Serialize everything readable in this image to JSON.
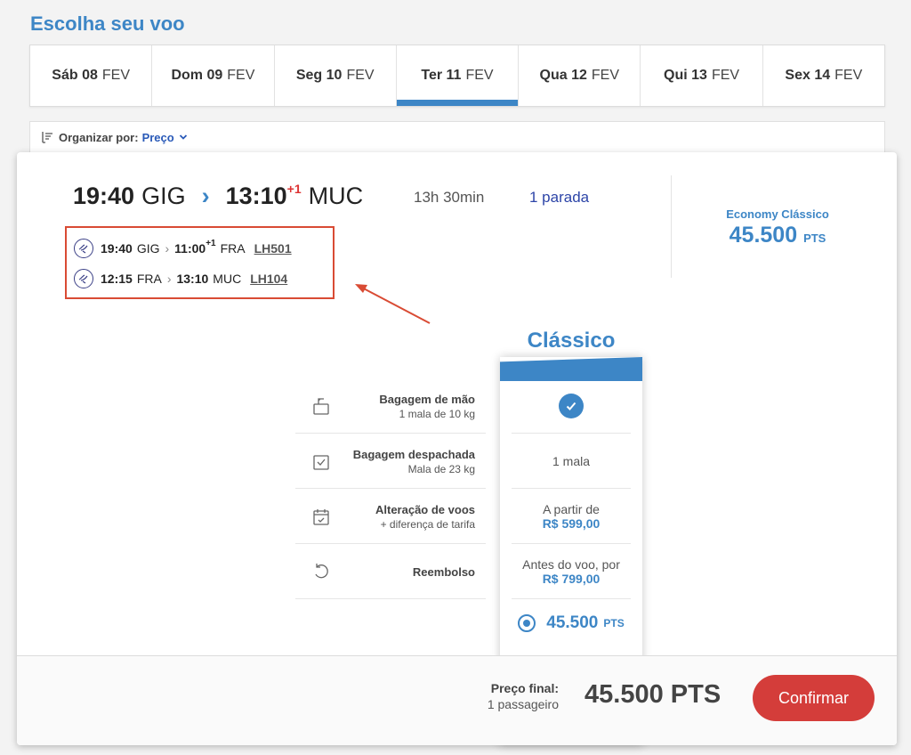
{
  "page_title": "Escolha seu voo",
  "date_tabs": [
    {
      "day": "Sáb 08",
      "month": "FEV",
      "active": false
    },
    {
      "day": "Dom 09",
      "month": "FEV",
      "active": false
    },
    {
      "day": "Seg 10",
      "month": "FEV",
      "active": false
    },
    {
      "day": "Ter 11",
      "month": "FEV",
      "active": true
    },
    {
      "day": "Qua 12",
      "month": "FEV",
      "active": false
    },
    {
      "day": "Qui 13",
      "month": "FEV",
      "active": false
    },
    {
      "day": "Sex 14",
      "month": "FEV",
      "active": false
    }
  ],
  "sort": {
    "label": "Organizar por:",
    "value": "Preço"
  },
  "flight": {
    "departure_time": "19:40",
    "departure_airport": "GIG",
    "arrival_time": "13:10",
    "arrival_day_offset": "+1",
    "arrival_airport": "MUC",
    "duration": "13h 30min",
    "stops": "1 parada",
    "segments": [
      {
        "dep_time": "19:40",
        "dep_airport": "GIG",
        "arr_time": "11:00",
        "arr_offset": "+1",
        "arr_airport": "FRA",
        "flight_code": "LH501"
      },
      {
        "dep_time": "12:15",
        "dep_airport": "FRA",
        "arr_time": "13:10",
        "arr_offset": "",
        "arr_airport": "MUC",
        "flight_code": "LH104"
      }
    ]
  },
  "economy": {
    "label": "Economy Clássico",
    "points": "45.500",
    "unit": "PTS"
  },
  "fare": {
    "name": "Clássico",
    "features": [
      {
        "title": "Bagagem de mão",
        "subtitle": "1 mala de 10 kg",
        "icon": "carry-on-bag-icon"
      },
      {
        "title": "Bagagem despachada",
        "subtitle": "Mala de 23 kg",
        "icon": "checked-bag-icon"
      },
      {
        "title": "Alteração de voos",
        "subtitle": "+ diferença de tarifa",
        "icon": "calendar-change-icon"
      },
      {
        "title": "Reembolso",
        "subtitle": "",
        "icon": "refund-icon"
      }
    ],
    "values": [
      {
        "text": "",
        "price": "",
        "check": true
      },
      {
        "text": "1 mala",
        "price": ""
      },
      {
        "text": "A partir de",
        "price": "R$ 599,00"
      },
      {
        "text": "Antes do voo, por",
        "price": "R$ 799,00"
      }
    ],
    "points": "45.500",
    "unit": "PTS"
  },
  "footer": {
    "final_label": "Preço final:",
    "passengers": "1 passageiro",
    "total": "45.500 PTS",
    "confirm_label": "Confirmar"
  },
  "colors": {
    "accent": "#3d86c6",
    "confirm": "#d43d3a",
    "highlight_box": "#d94b34",
    "stops_text": "#2d45a8"
  }
}
